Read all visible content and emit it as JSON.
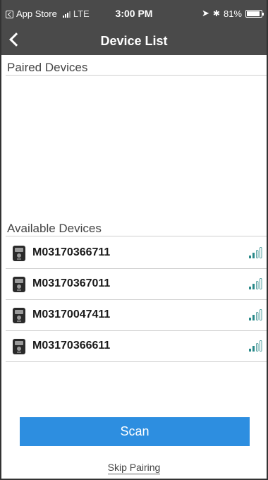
{
  "status_bar": {
    "carrier_back": "App Store",
    "network": "LTE",
    "time": "3:00 PM",
    "battery": "81%",
    "battery_level": 0.81
  },
  "navbar": {
    "title": "Device List"
  },
  "paired": {
    "header": "Paired Devices",
    "devices": []
  },
  "available": {
    "header": "Available Devices",
    "devices": [
      {
        "name": "M03170366711",
        "signal_bars": 2
      },
      {
        "name": "M03170367011",
        "signal_bars": 2
      },
      {
        "name": "M03170047411",
        "signal_bars": 2
      },
      {
        "name": "M03170366611",
        "signal_bars": 2
      }
    ]
  },
  "actions": {
    "scan_label": "Scan",
    "skip_label": "Skip Pairing"
  },
  "colors": {
    "topbar": "#4a4a4a",
    "scan_button": "#2d8ee0",
    "signal": "#2b8a8a"
  }
}
